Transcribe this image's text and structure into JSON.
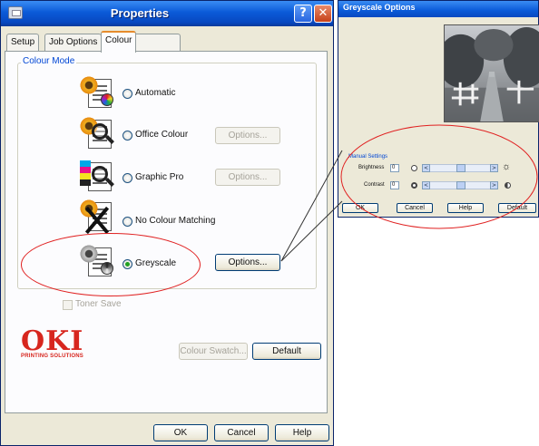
{
  "properties": {
    "title": "Properties",
    "help_btn": "?",
    "close_btn": "✕",
    "tabs": [
      {
        "label": "Setup"
      },
      {
        "label": "Job Options"
      },
      {
        "label": "Colour"
      }
    ],
    "group_label": "Colour Mode",
    "modes": [
      {
        "label": "Automatic"
      },
      {
        "label": "Office Colour",
        "button": "Options..."
      },
      {
        "label": "Graphic Pro",
        "button": "Options..."
      },
      {
        "label": "No Colour Matching"
      },
      {
        "label": "Greyscale",
        "button": "Options..."
      }
    ],
    "toner_save": "Toner Save",
    "logo_text": "OKI",
    "logo_sub": "PRINTING SOLUTIONS",
    "colour_swatch": "Colour Swatch...",
    "default_btn": "Default",
    "ok": "OK",
    "cancel": "Cancel",
    "help": "Help"
  },
  "greyscale": {
    "title": "Greyscale Options",
    "section": "Manual Settings",
    "brightness_label": "Brightness",
    "brightness_value": "0",
    "contrast_label": "Contrast",
    "contrast_value": "0",
    "ok": "OK",
    "cancel": "Cancel",
    "help": "Help",
    "default": "Default"
  },
  "colors": {
    "highlight": "#e02020",
    "group_label": "#0046d5",
    "titlebar": "#0a5ad8"
  }
}
